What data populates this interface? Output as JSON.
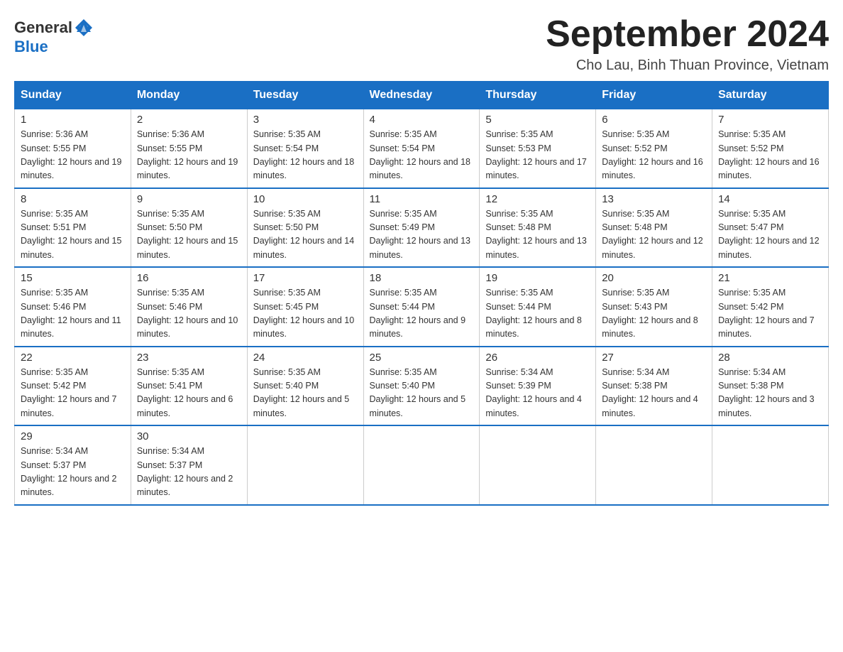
{
  "logo": {
    "general": "General",
    "blue": "Blue"
  },
  "header": {
    "title": "September 2024",
    "subtitle": "Cho Lau, Binh Thuan Province, Vietnam"
  },
  "weekdays": [
    "Sunday",
    "Monday",
    "Tuesday",
    "Wednesday",
    "Thursday",
    "Friday",
    "Saturday"
  ],
  "weeks": [
    [
      {
        "day": "1",
        "sunrise": "5:36 AM",
        "sunset": "5:55 PM",
        "daylight": "12 hours and 19 minutes."
      },
      {
        "day": "2",
        "sunrise": "5:36 AM",
        "sunset": "5:55 PM",
        "daylight": "12 hours and 19 minutes."
      },
      {
        "day": "3",
        "sunrise": "5:35 AM",
        "sunset": "5:54 PM",
        "daylight": "12 hours and 18 minutes."
      },
      {
        "day": "4",
        "sunrise": "5:35 AM",
        "sunset": "5:54 PM",
        "daylight": "12 hours and 18 minutes."
      },
      {
        "day": "5",
        "sunrise": "5:35 AM",
        "sunset": "5:53 PM",
        "daylight": "12 hours and 17 minutes."
      },
      {
        "day": "6",
        "sunrise": "5:35 AM",
        "sunset": "5:52 PM",
        "daylight": "12 hours and 16 minutes."
      },
      {
        "day": "7",
        "sunrise": "5:35 AM",
        "sunset": "5:52 PM",
        "daylight": "12 hours and 16 minutes."
      }
    ],
    [
      {
        "day": "8",
        "sunrise": "5:35 AM",
        "sunset": "5:51 PM",
        "daylight": "12 hours and 15 minutes."
      },
      {
        "day": "9",
        "sunrise": "5:35 AM",
        "sunset": "5:50 PM",
        "daylight": "12 hours and 15 minutes."
      },
      {
        "day": "10",
        "sunrise": "5:35 AM",
        "sunset": "5:50 PM",
        "daylight": "12 hours and 14 minutes."
      },
      {
        "day": "11",
        "sunrise": "5:35 AM",
        "sunset": "5:49 PM",
        "daylight": "12 hours and 13 minutes."
      },
      {
        "day": "12",
        "sunrise": "5:35 AM",
        "sunset": "5:48 PM",
        "daylight": "12 hours and 13 minutes."
      },
      {
        "day": "13",
        "sunrise": "5:35 AM",
        "sunset": "5:48 PM",
        "daylight": "12 hours and 12 minutes."
      },
      {
        "day": "14",
        "sunrise": "5:35 AM",
        "sunset": "5:47 PM",
        "daylight": "12 hours and 12 minutes."
      }
    ],
    [
      {
        "day": "15",
        "sunrise": "5:35 AM",
        "sunset": "5:46 PM",
        "daylight": "12 hours and 11 minutes."
      },
      {
        "day": "16",
        "sunrise": "5:35 AM",
        "sunset": "5:46 PM",
        "daylight": "12 hours and 10 minutes."
      },
      {
        "day": "17",
        "sunrise": "5:35 AM",
        "sunset": "5:45 PM",
        "daylight": "12 hours and 10 minutes."
      },
      {
        "day": "18",
        "sunrise": "5:35 AM",
        "sunset": "5:44 PM",
        "daylight": "12 hours and 9 minutes."
      },
      {
        "day": "19",
        "sunrise": "5:35 AM",
        "sunset": "5:44 PM",
        "daylight": "12 hours and 8 minutes."
      },
      {
        "day": "20",
        "sunrise": "5:35 AM",
        "sunset": "5:43 PM",
        "daylight": "12 hours and 8 minutes."
      },
      {
        "day": "21",
        "sunrise": "5:35 AM",
        "sunset": "5:42 PM",
        "daylight": "12 hours and 7 minutes."
      }
    ],
    [
      {
        "day": "22",
        "sunrise": "5:35 AM",
        "sunset": "5:42 PM",
        "daylight": "12 hours and 7 minutes."
      },
      {
        "day": "23",
        "sunrise": "5:35 AM",
        "sunset": "5:41 PM",
        "daylight": "12 hours and 6 minutes."
      },
      {
        "day": "24",
        "sunrise": "5:35 AM",
        "sunset": "5:40 PM",
        "daylight": "12 hours and 5 minutes."
      },
      {
        "day": "25",
        "sunrise": "5:35 AM",
        "sunset": "5:40 PM",
        "daylight": "12 hours and 5 minutes."
      },
      {
        "day": "26",
        "sunrise": "5:34 AM",
        "sunset": "5:39 PM",
        "daylight": "12 hours and 4 minutes."
      },
      {
        "day": "27",
        "sunrise": "5:34 AM",
        "sunset": "5:38 PM",
        "daylight": "12 hours and 4 minutes."
      },
      {
        "day": "28",
        "sunrise": "5:34 AM",
        "sunset": "5:38 PM",
        "daylight": "12 hours and 3 minutes."
      }
    ],
    [
      {
        "day": "29",
        "sunrise": "5:34 AM",
        "sunset": "5:37 PM",
        "daylight": "12 hours and 2 minutes."
      },
      {
        "day": "30",
        "sunrise": "5:34 AM",
        "sunset": "5:37 PM",
        "daylight": "12 hours and 2 minutes."
      },
      null,
      null,
      null,
      null,
      null
    ]
  ]
}
